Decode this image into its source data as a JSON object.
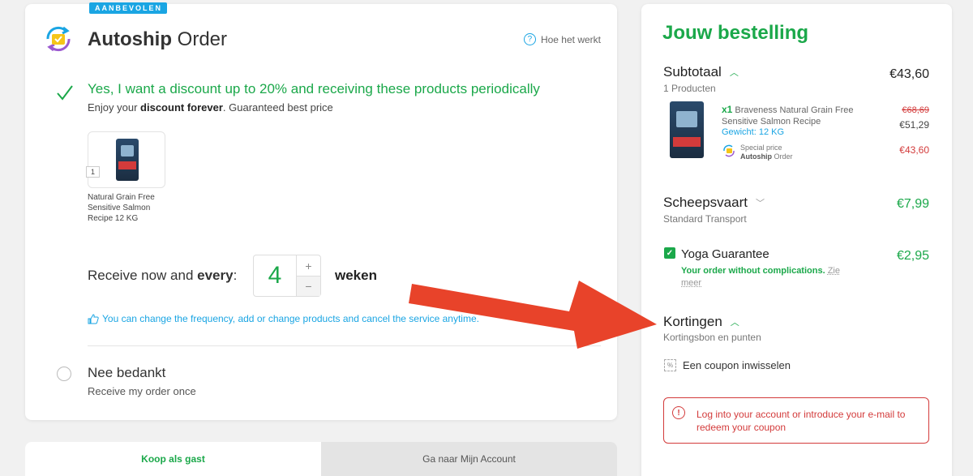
{
  "autoship": {
    "badge": "AANBEVOLEN",
    "title_bold": "Autoship",
    "title_rest": " Order",
    "help_label": "Hoe het werkt",
    "yes_title": "Yes, I want a discount up to 20% and receiving these products periodically",
    "yes_sub_prefix": "Enjoy your ",
    "yes_sub_bold": "discount forever",
    "yes_sub_suffix": ". Guaranteed best price",
    "product_qty": "1",
    "product_name": "Natural Grain Free Sensitive Salmon Recipe 12 KG",
    "receive_prefix": "Receive now and ",
    "receive_bold": "every",
    "receive_colon": ":",
    "frequency_value": "4",
    "stepper_plus": "+",
    "stepper_minus": "−",
    "frequency_unit": "weken",
    "note": "You can change the frequency, add or change products and cancel the service anytime.",
    "no_title": "Nee bedankt",
    "no_sub": "Receive my order once"
  },
  "tabs": [
    {
      "label": "Koop als gast"
    },
    {
      "label": "Ga naar Mijn Account"
    }
  ],
  "order": {
    "title": "Jouw bestelling",
    "subtotal_label": "Subtotaal",
    "subtotal_count": "1 Producten",
    "subtotal_price": "€43,60",
    "item": {
      "qty": "x1",
      "name": "Braveness Natural Grain Free Sensitive Salmon Recipe",
      "weight": "Gewicht: 12 KG",
      "special_line1": "Special price",
      "special_line2_bold": "Autoship",
      "special_line2_rest": " Order",
      "old_price": "€68,69",
      "mid_price": "€51,29",
      "new_price": "€43,60"
    },
    "shipping_label": "Scheepsvaart",
    "shipping_method": "Standard Transport",
    "shipping_price": "€7,99",
    "guarantee_label": "Yoga Guarantee",
    "guarantee_sub": "Your order without complications.",
    "guarantee_more": "Zie meer",
    "guarantee_price": "€2,95",
    "discounts_label": "Kortingen",
    "discounts_sub": "Kortingsbon en punten",
    "coupon_label": "Een coupon inwisselen",
    "alert_text": "Log into your account or introduce your e-mail to redeem your coupon"
  },
  "colors": {
    "accent_green": "#1ba84a",
    "accent_blue": "#1aa5e3",
    "alert_red": "#d33b3b",
    "arrow_red": "#e8432a"
  }
}
